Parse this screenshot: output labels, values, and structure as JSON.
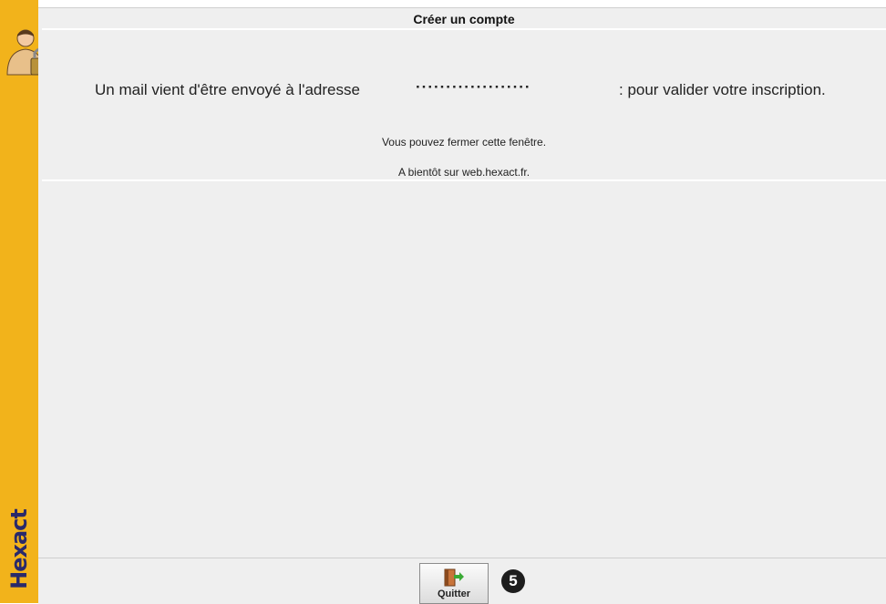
{
  "brand": {
    "logo_text": "Hexact"
  },
  "dialog": {
    "title": "Créer un compte",
    "message_part1": "Un mail vient d'être envoyé à l'adresse",
    "email_masked": "···················",
    "message_part2": ": pour valider votre inscription.",
    "close_hint": "Vous pouvez fermer cette fenêtre.",
    "farewell": "A bientôt sur web.hexact.fr."
  },
  "footer": {
    "quit_label": "Quitter",
    "step_badge": "5"
  },
  "colors": {
    "sidebar": "#f2b31b",
    "background": "#efefef",
    "logo": "#2a2a6a"
  },
  "icons": {
    "user": "user-lock-icon",
    "quit": "exit-door-icon"
  }
}
